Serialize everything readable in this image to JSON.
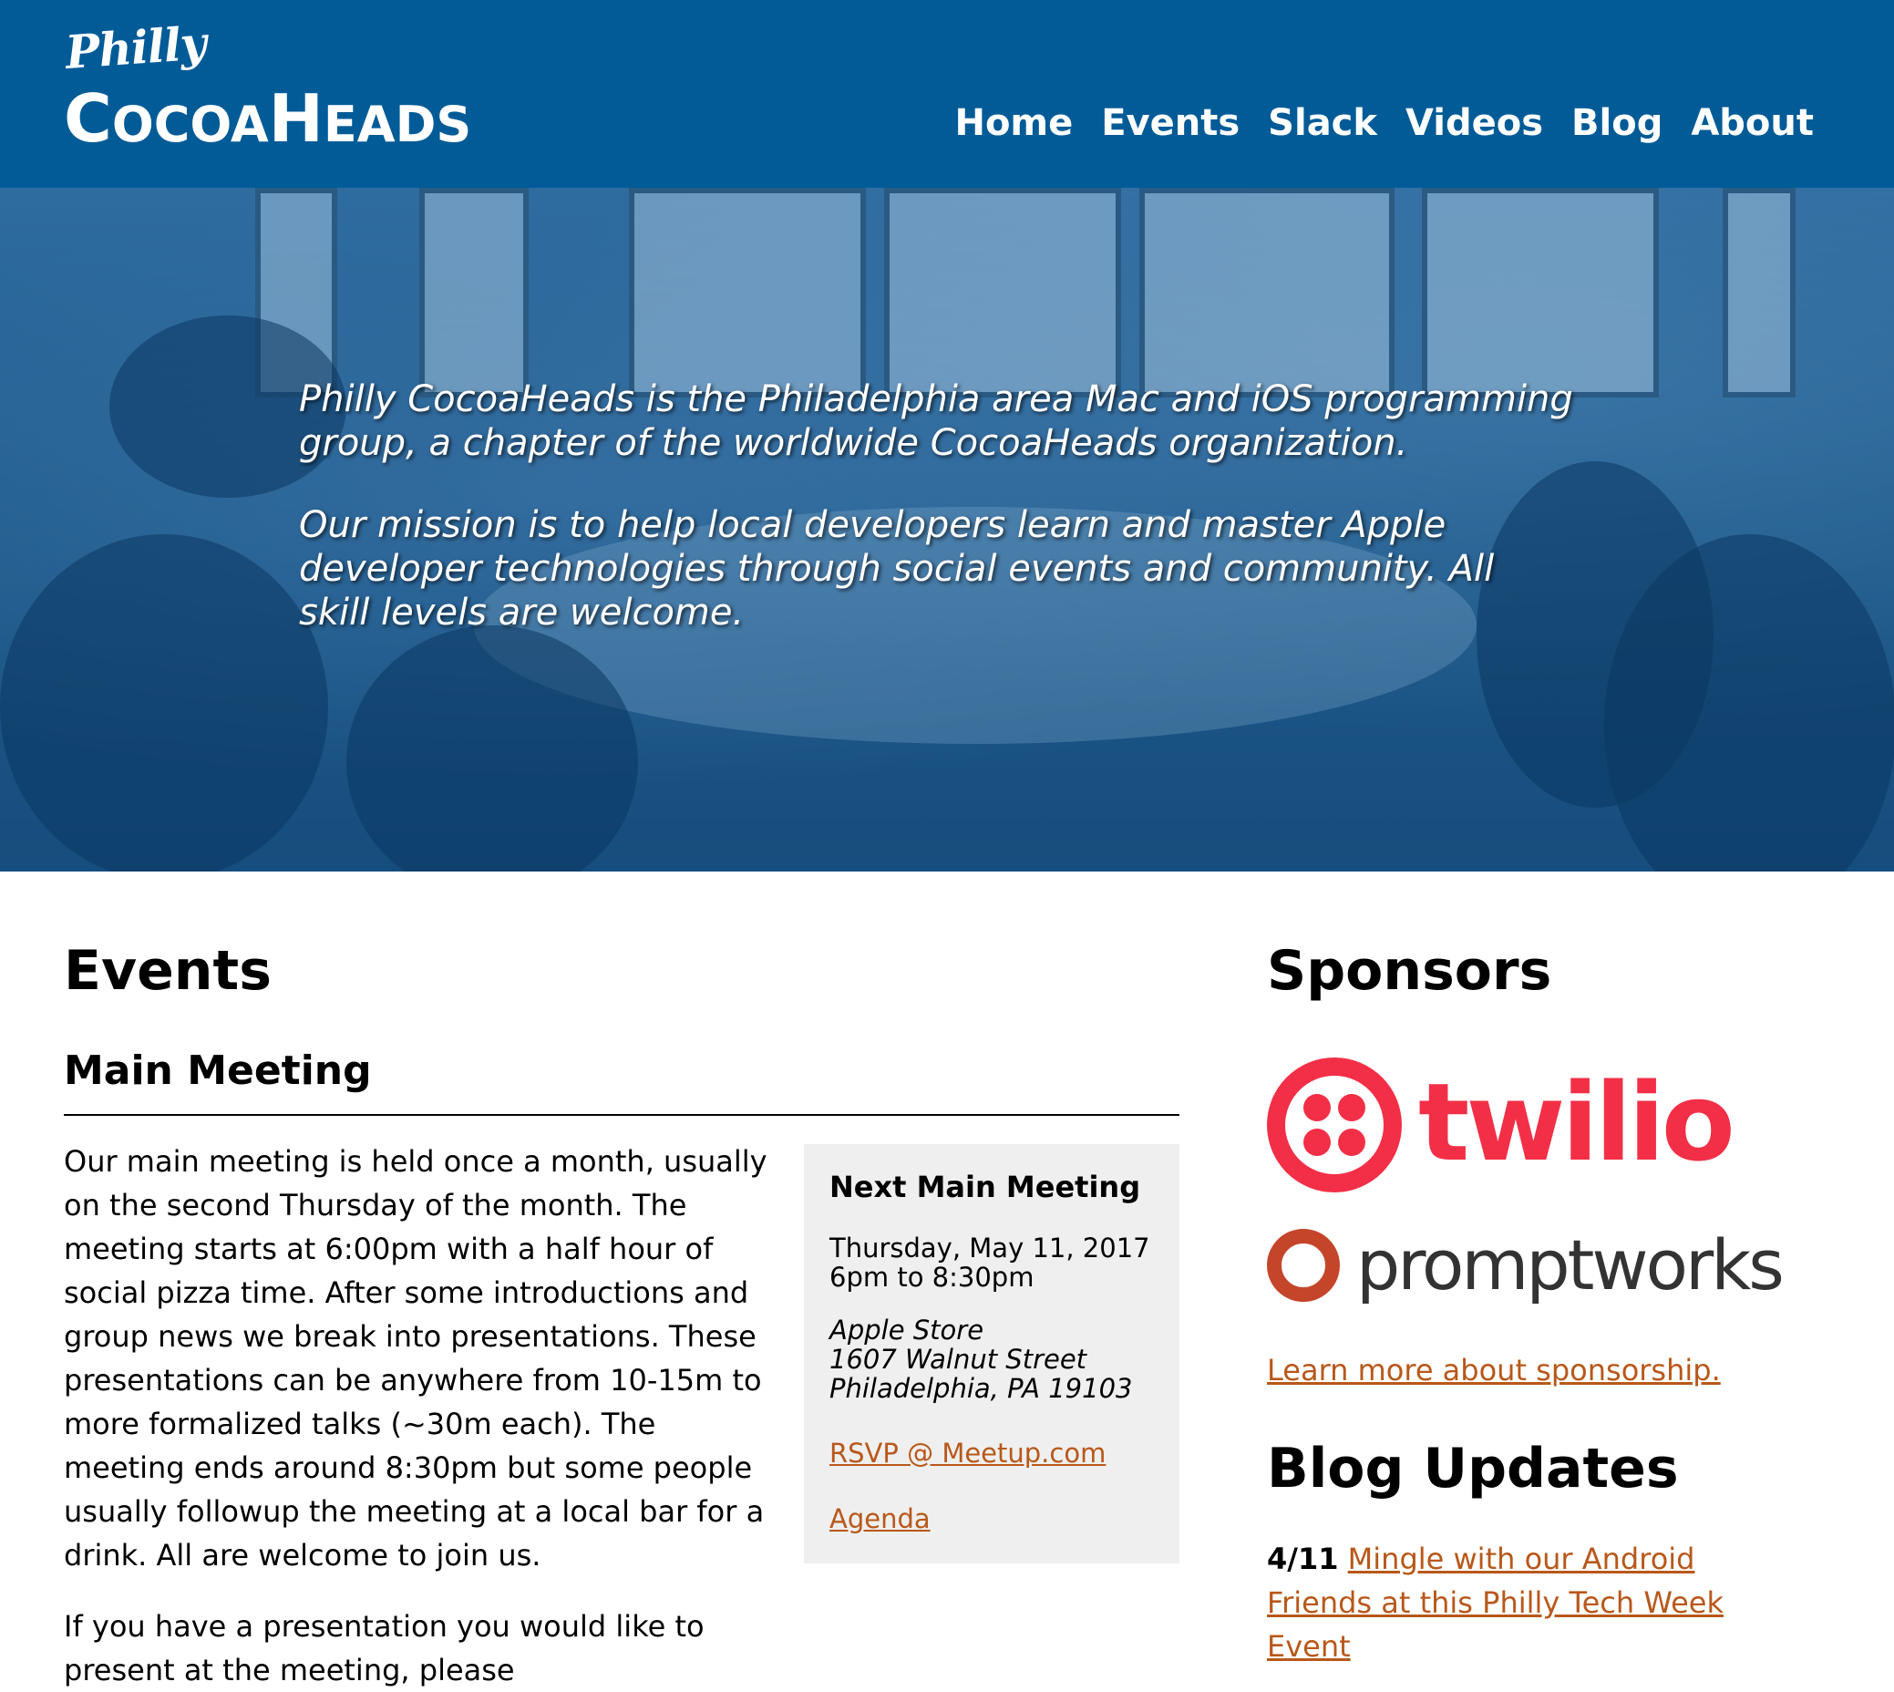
{
  "header": {
    "logo_script": "Philly",
    "logo_main_first": "C",
    "logo_main_rest1": "OCOA",
    "logo_main_second": "H",
    "logo_main_rest2": "EADS",
    "brand_color": "#005b97",
    "nav": [
      "Home",
      "Events",
      "Slack",
      "Videos",
      "Blog",
      "About"
    ]
  },
  "hero": {
    "paragraph1": "Philly CocoaHeads is the Philadelphia area Mac and iOS programming group, a chapter of the worldwide CocoaHeads organization.",
    "paragraph2": "Our mission is to help local developers learn and master Apple developer technologies through social events and community. All skill levels are welcome."
  },
  "events": {
    "title": "Events",
    "section_title": "Main Meeting",
    "body": "Our main meeting is held once a month, usually on the second Thursday of the month. The meeting starts at 6:00pm with a half hour of social pizza time. After some introductions and group news we break into presentations. These presentations can be anywhere from 10-15m to more formalized talks (~30m each). The meeting ends around 8:30pm but some people usually followup the meeting at a local bar for a drink. All are welcome to join us.",
    "next_paragraph_partial": "If you have a presentation you would like to present at the meeting, please",
    "next_meeting": {
      "title": "Next Main Meeting",
      "date": "Thursday, May 11, 2017",
      "time": "6pm to 8:30pm",
      "venue": "Apple Store",
      "street": "1607 Walnut Street",
      "city": "Philadelphia, PA 19103",
      "rsvp_link": "RSVP @ Meetup.com",
      "agenda_link": "Agenda"
    }
  },
  "sidebar": {
    "sponsors_title": "Sponsors",
    "sponsor1": "twilio",
    "sponsor2": "promptworks",
    "sponsor_link": "Learn more about sponsorship.",
    "blog_title": "Blog Updates",
    "blog_items": [
      {
        "date": "4/11",
        "title": "Mingle with our Android Friends at this Philly Tech Week Event"
      }
    ],
    "link_color": "#b8581a",
    "twilio_color": "#f22f46"
  }
}
